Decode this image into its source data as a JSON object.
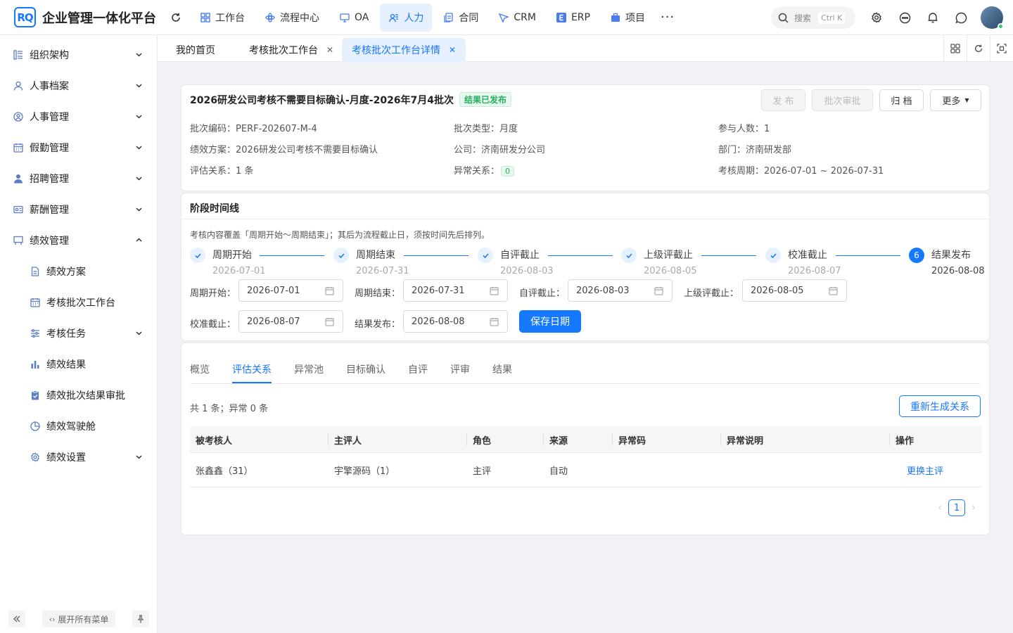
{
  "app": {
    "logo_text": "RQ",
    "title": "企业管理一体化平台"
  },
  "nav": {
    "items": [
      {
        "label": "工作台",
        "icon": "grid-icon"
      },
      {
        "label": "流程中心",
        "icon": "flow-icon"
      },
      {
        "label": "OA",
        "icon": "monitor-icon"
      },
      {
        "label": "人力",
        "icon": "people-icon",
        "active": true
      },
      {
        "label": "合同",
        "icon": "document-icon"
      },
      {
        "label": "CRM",
        "icon": "crm-icon"
      },
      {
        "label": "ERP",
        "icon": "erp-icon"
      },
      {
        "label": "项目",
        "icon": "briefcase-icon"
      }
    ],
    "more": "···"
  },
  "search": {
    "placeholder": "搜索",
    "shortcut": "Ctrl K"
  },
  "sidebar": {
    "items": [
      {
        "label": "组织架构",
        "icon": "org-icon",
        "expandable": true
      },
      {
        "label": "人事档案",
        "icon": "user-icon",
        "expandable": true
      },
      {
        "label": "人事管理",
        "icon": "user-circle-icon",
        "expandable": true
      },
      {
        "label": "假勤管理",
        "icon": "calendar-icon",
        "expandable": true
      },
      {
        "label": "招聘管理",
        "icon": "person-icon",
        "expandable": true
      },
      {
        "label": "薪酬管理",
        "icon": "salary-icon",
        "expandable": true
      },
      {
        "label": "绩效管理",
        "icon": "board-icon",
        "expandable": true,
        "expanded": true
      }
    ],
    "sub_items": [
      {
        "label": "绩效方案",
        "icon": "file-icon"
      },
      {
        "label": "考核批次工作台",
        "icon": "calendar-icon",
        "selected": true
      },
      {
        "label": "考核任务",
        "icon": "sliders-icon",
        "expandable": true
      },
      {
        "label": "绩效结果",
        "icon": "bar-chart-icon"
      },
      {
        "label": "绩效批次结果审批",
        "icon": "clipboard-check-icon"
      },
      {
        "label": "绩效驾驶舱",
        "icon": "pie-icon"
      },
      {
        "label": "绩效设置",
        "icon": "gear-icon",
        "expandable": true
      }
    ],
    "expand_all": "展开所有菜单"
  },
  "page_tabs": [
    {
      "label": "我的首页",
      "closable": false
    },
    {
      "label": "考核批次工作台",
      "closable": true
    },
    {
      "label": "考核批次工作台详情",
      "closable": true,
      "active": true
    }
  ],
  "batch": {
    "title": "2026研发公司考核不需要目标确认-月度-2026年7月4批次",
    "status": "结果已发布",
    "actions": {
      "publish": "发 布",
      "approve": "批次审批",
      "archive": "归 档",
      "more": "更多"
    },
    "fields": {
      "code_label": "批次编码：",
      "code": "PERF-202607-M-4",
      "type_label": "批次类型：",
      "type": "月度",
      "count_label": "参与人数：",
      "count": "1",
      "plan_label": "绩效方案：",
      "plan": "2026研发公司考核不需要目标确认",
      "company_label": "公司：",
      "company": "济南研发分公司",
      "dept_label": "部门：",
      "dept": "济南研发部",
      "relation_label": "评估关系：",
      "relation": "1 条",
      "abnormal_label": "异常关系：",
      "abnormal": "0",
      "period_label": "考核周期：",
      "period": "2026-07-01 ~ 2026-07-31"
    }
  },
  "timeline": {
    "title": "阶段时间线",
    "hint": "考核内容覆盖「周期开始～周期结束」；其后为流程截止日，须按时间先后排列。",
    "steps": [
      {
        "name": "周期开始",
        "date": "2026-07-01",
        "done": true
      },
      {
        "name": "周期结束",
        "date": "2026-07-31",
        "done": true
      },
      {
        "name": "自评截止",
        "date": "2026-08-03",
        "done": true
      },
      {
        "name": "上级评截止",
        "date": "2026-08-05",
        "done": true
      },
      {
        "name": "校准截止",
        "date": "2026-08-07",
        "done": true
      },
      {
        "name": "结果发布",
        "date": "2026-08-08",
        "num": "6",
        "current": true
      }
    ],
    "form": [
      {
        "label": "周期开始：",
        "value": "2026-07-01"
      },
      {
        "label": "周期结束：",
        "value": "2026-07-31"
      },
      {
        "label": "自评截止：",
        "value": "2026-08-03"
      },
      {
        "label": "上级评截止：",
        "value": "2026-08-05"
      },
      {
        "label": "校准截止：",
        "value": "2026-08-07"
      },
      {
        "label": "结果发布：",
        "value": "2026-08-08"
      }
    ],
    "save": "保存日期"
  },
  "detail": {
    "tabs": [
      "概览",
      "评估关系",
      "异常池",
      "目标确认",
      "自评",
      "评审",
      "结果"
    ],
    "active_tab": "评估关系",
    "summary": "共 1 条；异常 0 条",
    "regen": "重新生成关系",
    "columns": [
      "被考核人",
      "主评人",
      "角色",
      "来源",
      "异常码",
      "异常说明",
      "操作"
    ],
    "rows": [
      {
        "employee": "张鑫鑫（31）",
        "reviewer": "宇擎源码（1）",
        "role": "主评",
        "source": "自动",
        "code": "",
        "note": "",
        "action": "更换主评"
      }
    ],
    "page": "1"
  }
}
